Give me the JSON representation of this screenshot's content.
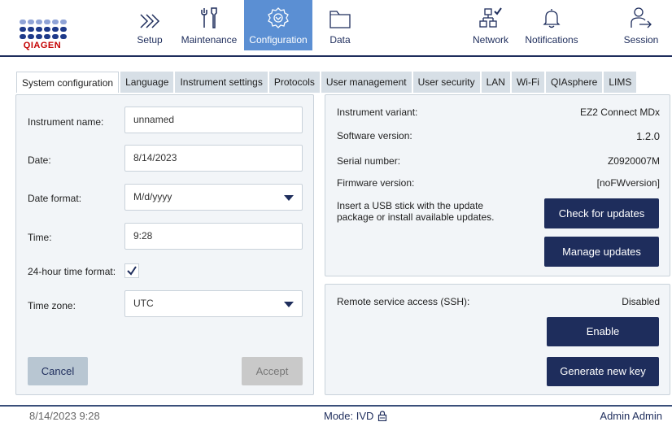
{
  "header": {
    "logo_text": "QIAGEN",
    "nav": [
      {
        "label": "Setup",
        "icon": "setup-chevrons-icon"
      },
      {
        "label": "Maintenance",
        "icon": "tools-icon"
      },
      {
        "label": "Configuration",
        "icon": "gear-icon",
        "active": true
      },
      {
        "label": "Data",
        "icon": "folder-icon"
      },
      {
        "label": "Network",
        "icon": "network-icon"
      },
      {
        "label": "Notifications",
        "icon": "bell-icon"
      },
      {
        "label": "Session",
        "icon": "user-logout-icon"
      }
    ]
  },
  "tabs": [
    "System configuration",
    "Language",
    "Instrument settings",
    "Protocols",
    "User management",
    "User security",
    "LAN",
    "Wi-Fi",
    "QIAsphere",
    "LIMS"
  ],
  "system_config": {
    "instrument_name_label": "Instrument name:",
    "instrument_name_value": "unnamed",
    "date_label": "Date:",
    "date_value": "8/14/2023",
    "date_format_label": "Date format:",
    "date_format_value": "M/d/yyyy",
    "time_label": "Time:",
    "time_value": "9:28",
    "hour24_label": "24-hour time format:",
    "hour24_checked": true,
    "timezone_label": "Time zone:",
    "timezone_value": "UTC",
    "cancel_label": "Cancel",
    "accept_label": "Accept"
  },
  "instrument_info": {
    "variant_label": "Instrument variant:",
    "variant_value": "EZ2 Connect MDx",
    "software_label": "Software version:",
    "software_value": "1.2.0",
    "serial_label": "Serial number:",
    "serial_value": "Z0920007M",
    "firmware_label": "Firmware version:",
    "firmware_value": "[noFWversion]",
    "update_text": "Insert a USB stick with the update package or install available updates.",
    "check_updates_label": "Check for updates",
    "manage_updates_label": "Manage updates"
  },
  "ssh": {
    "label": "Remote service access (SSH):",
    "status": "Disabled",
    "enable_label": "Enable",
    "generate_key_label": "Generate new key"
  },
  "footer": {
    "datetime": "8/14/2023 9:28",
    "mode": "Mode: IVD",
    "user": "Admin Admin"
  },
  "colors": {
    "brand_dark": "#1e2d5c",
    "active_nav": "#5b8fd3",
    "qiagen_red": "#c40000"
  }
}
